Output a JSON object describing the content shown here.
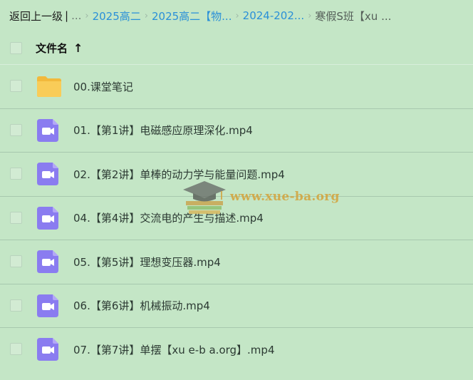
{
  "breadcrumb": {
    "back": "返回上一级",
    "divider": "|",
    "ellipsis": "...",
    "items": [
      "2025高二",
      "2025高二【物...",
      "2024-202...",
      "寒假S班【xu ..."
    ]
  },
  "table": {
    "header_label": "文件名",
    "sort_icon": "arrow-up-icon",
    "sort_arrow": "↑"
  },
  "files": [
    {
      "name": "00.课堂笔记",
      "type": "folder",
      "icon": "folder-icon"
    },
    {
      "name": "01.【第1讲】电磁感应原理深化.mp4",
      "type": "video",
      "icon": "video-icon"
    },
    {
      "name": "02.【第2讲】单棒的动力学与能量问题.mp4",
      "type": "video",
      "icon": "video-icon"
    },
    {
      "name": "04.【第4讲】交流电的产生与描述.mp4",
      "type": "video",
      "icon": "video-icon"
    },
    {
      "name": "05.【第5讲】理想变压器.mp4",
      "type": "video",
      "icon": "video-icon"
    },
    {
      "name": "06.【第6讲】机械振动.mp4",
      "type": "video",
      "icon": "video-icon"
    },
    {
      "name": "07.【第7讲】单摆【xu e-b a.org】.mp4",
      "type": "video",
      "icon": "video-icon"
    }
  ],
  "watermark": {
    "text": "www.xue-ba.org",
    "icon": "graduation-cap-icon"
  },
  "colors": {
    "background": "#c4e6c6",
    "link": "#2a90d8",
    "folder": "#f7c750",
    "video": "#8a7cf0",
    "watermark": "#d4a23a"
  }
}
